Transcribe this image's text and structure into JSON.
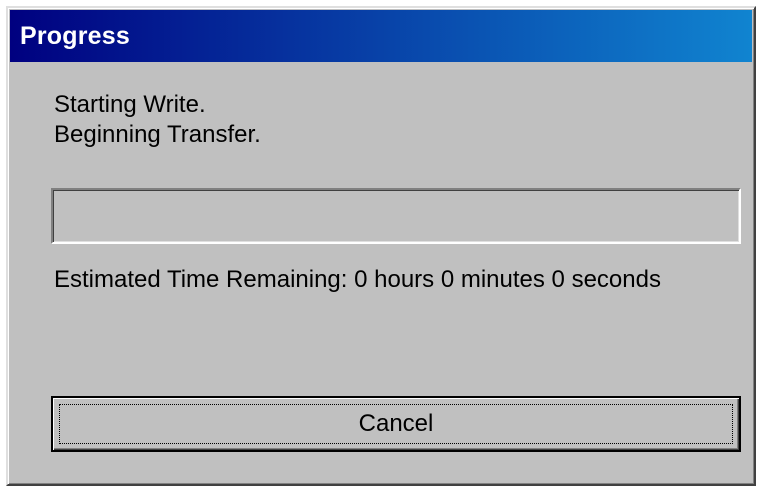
{
  "window": {
    "title": "Progress"
  },
  "status": {
    "lines": [
      "Starting Write.",
      "Beginning Transfer."
    ]
  },
  "progress": {
    "value_percent": 0
  },
  "estimate": {
    "text": "Estimated Time Remaining: 0 hours 0 minutes 0 seconds"
  },
  "actions": {
    "cancel_label": "Cancel"
  },
  "colors": {
    "titlebar_start": "#000080",
    "titlebar_end": "#1084d0",
    "face": "#c0c0c0"
  }
}
